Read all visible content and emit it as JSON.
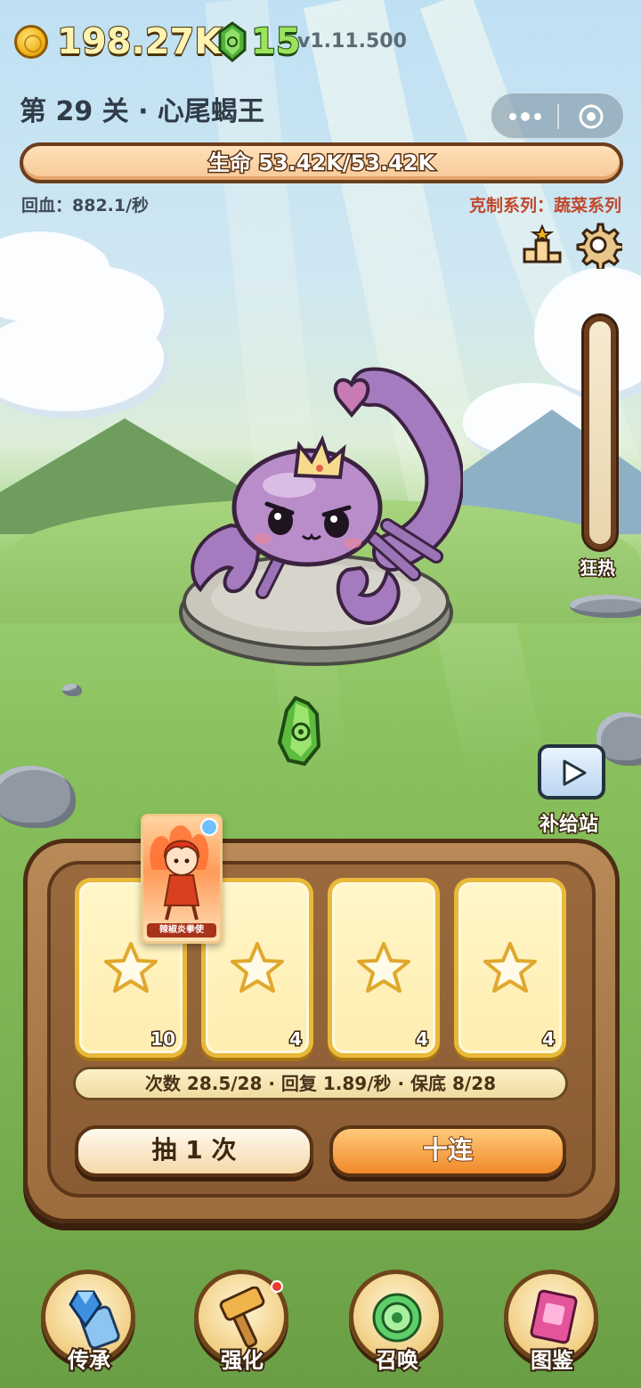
{
  "top": {
    "coins": "198.27K",
    "gems": "15",
    "version": "v1.11.500"
  },
  "level": {
    "title": "第 29 关 · 心尾蝎王"
  },
  "boss": {
    "hp_text": "生命 53.42K/53.42K",
    "hp_fraction": 1.0,
    "regen": "回血：882.1/秒",
    "counter": "克制系列：蔬菜系列"
  },
  "fever": {
    "label": "狂热",
    "level": 0
  },
  "supply": {
    "label": "补给站"
  },
  "draw_panel": {
    "slots": [
      {
        "count": "10"
      },
      {
        "count": "4"
      },
      {
        "count": "4"
      },
      {
        "count": "4"
      }
    ],
    "card_name": "辣椒炎拳使",
    "info": "次数 28.5/28 · 回复 1.89/秒 · 保底 8/28",
    "draw_one": "抽 1 次",
    "draw_ten": "十连"
  },
  "nav": [
    {
      "label": "传承",
      "icon": "crystal-scroll-icon"
    },
    {
      "label": "强化",
      "icon": "hammer-icon"
    },
    {
      "label": "召唤",
      "icon": "summon-orb-icon"
    },
    {
      "label": "图鉴",
      "icon": "book-icon"
    }
  ],
  "colors": {
    "hp_fill": "#f6c997",
    "counter_text": "#c0492c",
    "regen_text": "#3e4a55",
    "accent_orange": "#f08a2a"
  }
}
